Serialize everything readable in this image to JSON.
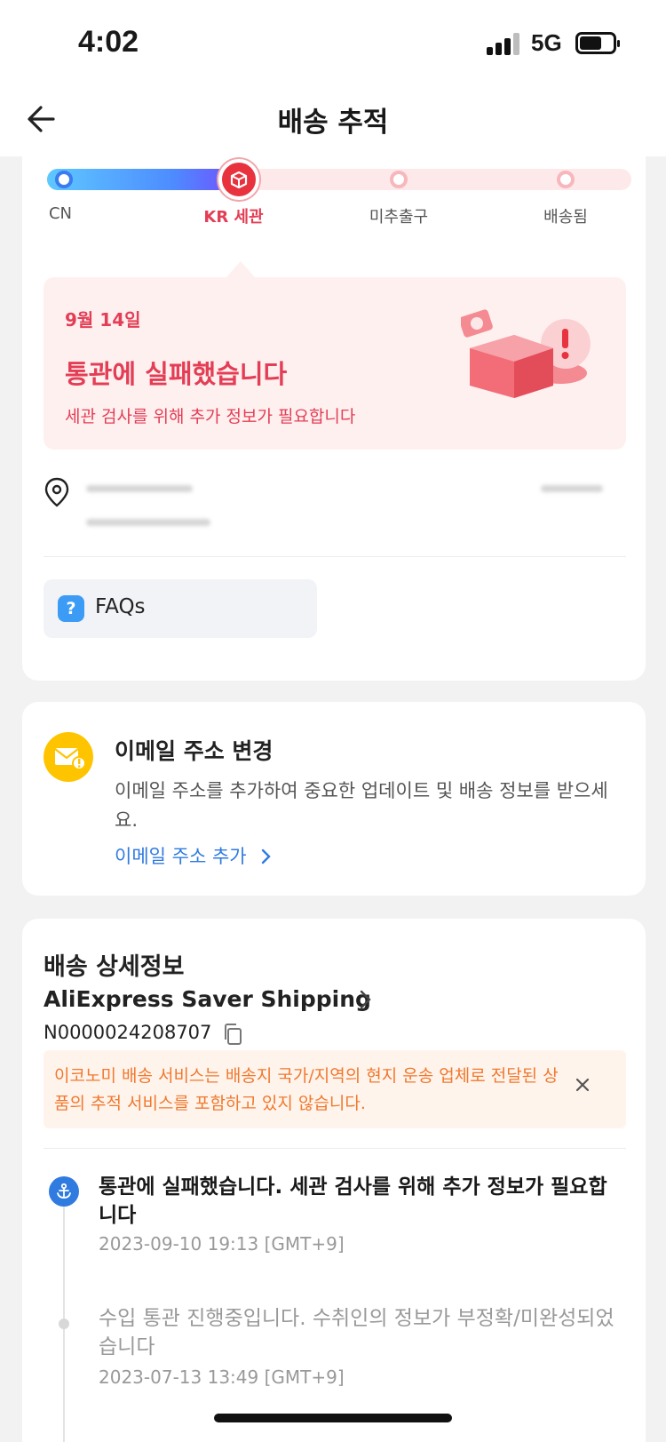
{
  "status_bar": {
    "time": "4:02",
    "network": "5G"
  },
  "header": {
    "title": "배송 추적"
  },
  "tracking": {
    "steps": [
      {
        "label": "CN",
        "state": "done"
      },
      {
        "label": "KR 세관",
        "state": "current"
      },
      {
        "label": "미추출구",
        "state": "pending"
      },
      {
        "label": "배송됨",
        "state": "pending"
      }
    ],
    "status": {
      "date": "9월 14일",
      "title": "통관에 실패했습니다",
      "subtitle": "세관 검사를 위해 추가 정보가 필요합니다"
    },
    "faq_label": "FAQs"
  },
  "email": {
    "title": "이메일 주소 변경",
    "description": "이메일 주소를 추가하여 중요한 업데이트 및 배송 정보를 받으세요.",
    "link_label": "이메일 주소 추가"
  },
  "details": {
    "title": "배송 상세정보",
    "carrier": "AliExpress Saver Shipping",
    "tracking_number": "N0000024208707",
    "notice": "이코노미 배송 서비스는 배송지 국가/지역의 현지 운송 업체로 전달된 상품의 추적 서비스를 포함하고 있지 않습니다.",
    "events": [
      {
        "text": "통관에 실패했습니다. 세관 검사를 위해 추가 정보가 필요합니다",
        "time": "2023-09-10 19:13 [GMT+9]"
      },
      {
        "text": "수입 통관 진행중입니다. 수취인의 정보가 부정확/미완성되었습니다",
        "time": "2023-07-13 13:49 [GMT+9]"
      }
    ]
  },
  "colors": {
    "accent_red": "#e33e55",
    "link_blue": "#2f7be0",
    "notice_orange": "#f0782e",
    "email_yellow": "#ffc400"
  },
  "icons": [
    "back-arrow-icon",
    "box-icon",
    "location-pin-icon",
    "question-icon",
    "mail-warning-icon",
    "chevron-right-icon",
    "copy-icon",
    "close-icon",
    "anchor-icon"
  ]
}
